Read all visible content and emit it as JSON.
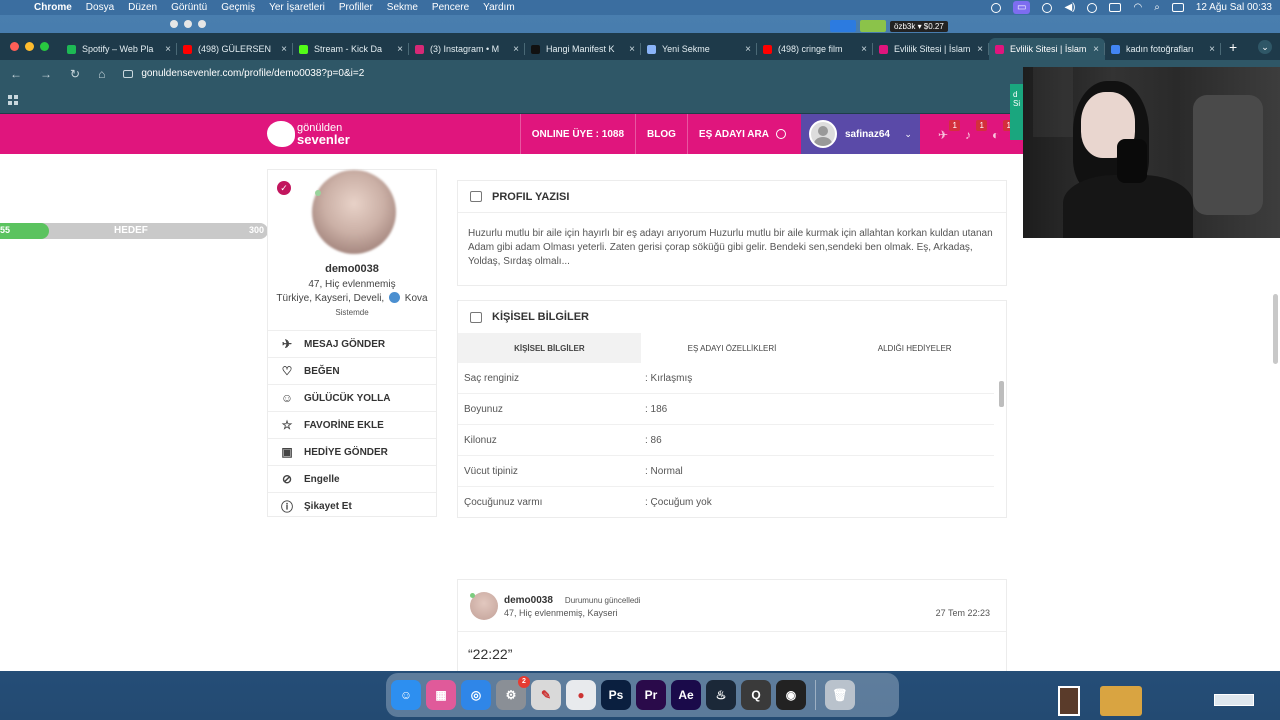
{
  "menubar": {
    "app": "Chrome",
    "items": [
      "Dosya",
      "Düzen",
      "Görüntü",
      "Geçmiş",
      "Yer İşaretleri",
      "Profiller",
      "Sekme",
      "Pencere",
      "Yardım"
    ],
    "stock": "özb3k ▾ $0.27",
    "clock": "12 Ağu Sal  00:33"
  },
  "tabs": [
    {
      "title": "Spotify – Web Pla",
      "color": "#1db954"
    },
    {
      "title": "(498) GÜLERSEN",
      "color": "#ff0000"
    },
    {
      "title": "Stream - Kick Da",
      "color": "#53fc18"
    },
    {
      "title": "(3) Instagram • M",
      "color": "#d62976"
    },
    {
      "title": "Hangi Manifest K",
      "color": "#111111"
    },
    {
      "title": "Yeni Sekme",
      "color": "#8ab4f8"
    },
    {
      "title": "(498) cringe film",
      "color": "#ff0000"
    },
    {
      "title": "Evlilik Sitesi | İslam",
      "color": "#e0157d"
    },
    {
      "title": "Evlilik Sitesi | İslam",
      "color": "#e0157d"
    },
    {
      "title": "kadın fotoğrafları",
      "color": "#4285f4"
    }
  ],
  "url": "gonuldensevenler.com/profile/demo0038?p=0&i=2",
  "site": {
    "logo_top": "gönülden",
    "logo_bottom": "sevenler",
    "nav": {
      "online": "ONLINE ÜYE : 1088",
      "blog": "BLOG",
      "search": "EŞ ADAYI ARA"
    },
    "username": "safinaz64",
    "badges": [
      "1",
      "1",
      "1"
    ],
    "side_tab": "d\nSi"
  },
  "progress": {
    "left": "55",
    "center": "HEDEF",
    "right": "300",
    "fraction": 0.183
  },
  "profile": {
    "name": "demo0038",
    "info": "47, Hiç evlenmemiş",
    "location": "Türkiye, Kayseri, Develi,",
    "zodiac": "Kova",
    "status": "Sistemde",
    "actions": [
      {
        "label": "MESAJ GÖNDER",
        "icon": "send-icon"
      },
      {
        "label": "BEĞEN",
        "icon": "heart-icon"
      },
      {
        "label": "GÜLÜCÜK YOLLA",
        "icon": "smile-icon"
      },
      {
        "label": "FAVORİNE EKLE",
        "icon": "star-icon"
      },
      {
        "label": "HEDİYE GÖNDER",
        "icon": "gift-icon"
      },
      {
        "label": "Engelle",
        "icon": "block-icon"
      },
      {
        "label": "Şikayet Et",
        "icon": "alert-icon"
      }
    ]
  },
  "about": {
    "title": "PROFIL YAZISI",
    "text": "Huzurlu mutlu bir aile için hayırlı bir eş adayı arıyorum Huzurlu mutlu bir aile kurmak için allahtan korkan kuldan utanan Adam gibi adam Olması yeterli. Zaten gerisi çorap söküğü gibi gelir. Bendeki sen,sendeki ben olmak. Eş, Arkadaş, Yoldaş, Sırdaş olmalı..."
  },
  "personal": {
    "title": "KİŞİSEL BİLGİLER",
    "tabs": [
      "KİŞİSEL BİLGİLER",
      "EŞ ADAYI ÖZELLİKLERİ",
      "ALDIĞI HEDİYELER"
    ],
    "rows": [
      {
        "key": "Saç renginiz",
        "value": ": Kırlaşmış"
      },
      {
        "key": "Boyunuz",
        "value": ": 186"
      },
      {
        "key": "Kilonuz",
        "value": ": 86"
      },
      {
        "key": "Vücut tipiniz",
        "value": ": Normal"
      },
      {
        "key": "Çocuğunuz varmı",
        "value": ": Çocuğum yok"
      }
    ]
  },
  "post": {
    "author": "demo0038",
    "action": "Durumunu güncelledi",
    "info": "47, Hiç evlenmemiş, Kayseri",
    "date": "27 Tem 22:23",
    "text": "“22:22”"
  },
  "dock": {
    "apps": [
      {
        "name": "finder",
        "label": "☺",
        "color": "#2d8ff0"
      },
      {
        "name": "launchpad",
        "label": "▦",
        "color": "#e05a9a"
      },
      {
        "name": "safari",
        "label": "◎",
        "color": "#2f86e8"
      },
      {
        "name": "settings",
        "label": "⚙",
        "color": "#8a8f96",
        "badge": "2"
      },
      {
        "name": "notes",
        "label": "✎",
        "color": "#d9d9d9"
      },
      {
        "name": "chrome",
        "label": "●",
        "color": "#e8eaed"
      },
      {
        "name": "photoshop",
        "label": "Ps",
        "color": "#0a1f3f"
      },
      {
        "name": "premiere",
        "label": "Pr",
        "color": "#2a0a4a"
      },
      {
        "name": "after-effects",
        "label": "Ae",
        "color": "#1a0a4a"
      },
      {
        "name": "steam",
        "label": "♨",
        "color": "#1b2838"
      },
      {
        "name": "quicktime",
        "label": "Q",
        "color": "#3a3a3a"
      },
      {
        "name": "obs",
        "label": "◉",
        "color": "#222222"
      },
      {
        "name": "trash",
        "label": "🗑",
        "color": "#b9c2cc"
      }
    ]
  }
}
